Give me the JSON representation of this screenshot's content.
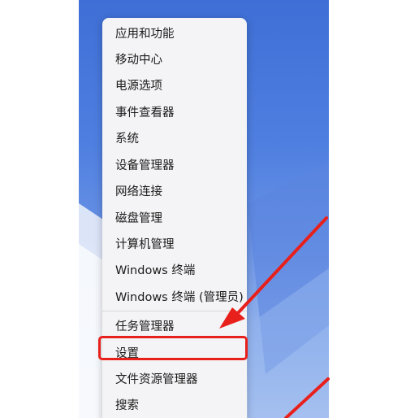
{
  "context_menu": {
    "items": [
      {
        "label": "应用和功能"
      },
      {
        "label": "移动中心"
      },
      {
        "label": "电源选项"
      },
      {
        "label": "事件查看器"
      },
      {
        "label": "系统"
      },
      {
        "label": "设备管理器"
      },
      {
        "label": "网络连接"
      },
      {
        "label": "磁盘管理"
      },
      {
        "label": "计算机管理"
      },
      {
        "label": "Windows 终端"
      },
      {
        "label": "Windows 终端 (管理员)"
      },
      {
        "label": "任务管理器"
      },
      {
        "label": "设置"
      },
      {
        "label": "文件资源管理器"
      },
      {
        "label": "搜索"
      }
    ]
  },
  "annotation": {
    "highlight_color": "#e8201c",
    "arrow_color": "#e8201c"
  },
  "wallpaper": {
    "primary_color": "#3f6fd6",
    "light_color": "#c5d6f4"
  }
}
